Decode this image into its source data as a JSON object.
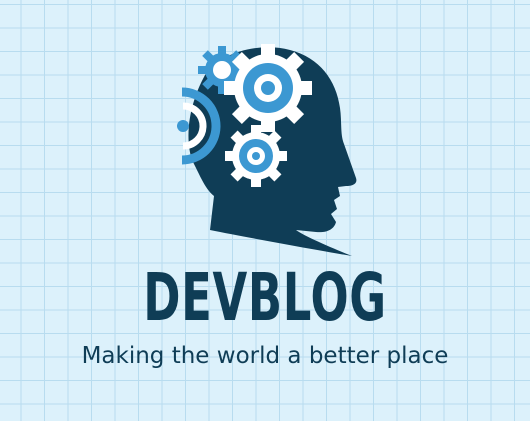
{
  "brand": {
    "name": "DEVBLOG",
    "tagline": "Making the world a better place"
  },
  "colors": {
    "background": "#dcf1fb",
    "grid": "#b8dcef",
    "navy": "#0f3d56",
    "accent_blue": "#3c98d2",
    "white": "#ffffff"
  },
  "icons": {
    "logo": "head-with-gears-icon"
  }
}
